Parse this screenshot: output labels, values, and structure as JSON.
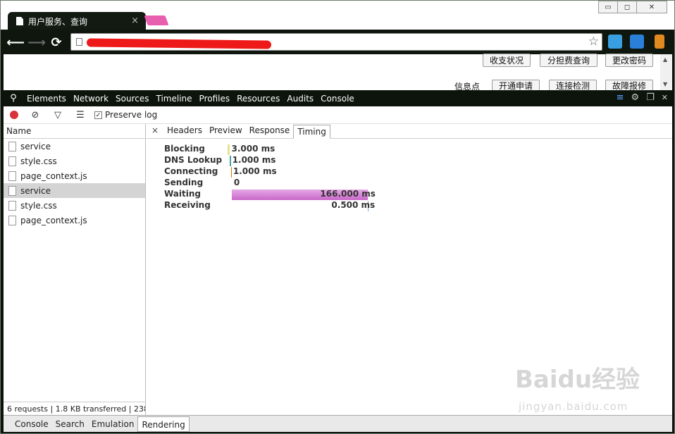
{
  "browser": {
    "tab_title": "用户服务、查询",
    "tab_close": "×",
    "win_controls": [
      "▭",
      "◻",
      "✕"
    ],
    "nav": {
      "back": "⟵",
      "forward": "⟶",
      "reload": "⟳"
    },
    "star": "☆",
    "accent_colors": {
      "new_tab": "#e85fb0",
      "redaction": "#ee1a1a"
    }
  },
  "page": {
    "buttons_row1": [
      "收支状况",
      "分担费查询",
      "更改密码"
    ],
    "info_label": "信息点",
    "buttons_row2": [
      "开通申请",
      "连接检测",
      "故障报修"
    ]
  },
  "devtools": {
    "tabs": [
      "Elements",
      "Network",
      "Sources",
      "Timeline",
      "Profiles",
      "Resources",
      "Audits",
      "Console"
    ],
    "preserve_log": "Preserve log",
    "preserve_checked": "✓",
    "name_header": "Name",
    "requests": [
      "service",
      "style.css",
      "page_context.js",
      "service",
      "style.css",
      "page_context.js"
    ],
    "selected_request": "service",
    "status": "6 requests | 1.8 KB transferred | 238 ...",
    "detail_close": "×",
    "detail_tabs": [
      "Headers",
      "Preview",
      "Response",
      "Timing"
    ],
    "active_detail_tab": "Timing",
    "timing": [
      {
        "label": "Blocking",
        "value": "3.000 ms",
        "ms": 3.0,
        "color": "#e7e38a"
      },
      {
        "label": "DNS Lookup",
        "value": "1.000 ms",
        "ms": 1.0,
        "color": "#49a3a3"
      },
      {
        "label": "Connecting",
        "value": "1.000 ms",
        "ms": 1.0,
        "color": "#d37b00"
      },
      {
        "label": "Sending",
        "value": "0",
        "ms": 0,
        "color": "#7aa4d8"
      },
      {
        "label": "Waiting",
        "value": "166.000 ms",
        "ms": 166.0,
        "color": "#d89ad8"
      },
      {
        "label": "Receiving",
        "value": "0.500 ms",
        "ms": 0.5,
        "color": "#7aa4d8"
      }
    ],
    "drawer_tabs": [
      "Console",
      "Search",
      "Emulation",
      "Rendering"
    ],
    "active_drawer_tab": "Rendering"
  },
  "watermark": {
    "brand": "Baidu经验",
    "url": "jingyan.baidu.com"
  }
}
